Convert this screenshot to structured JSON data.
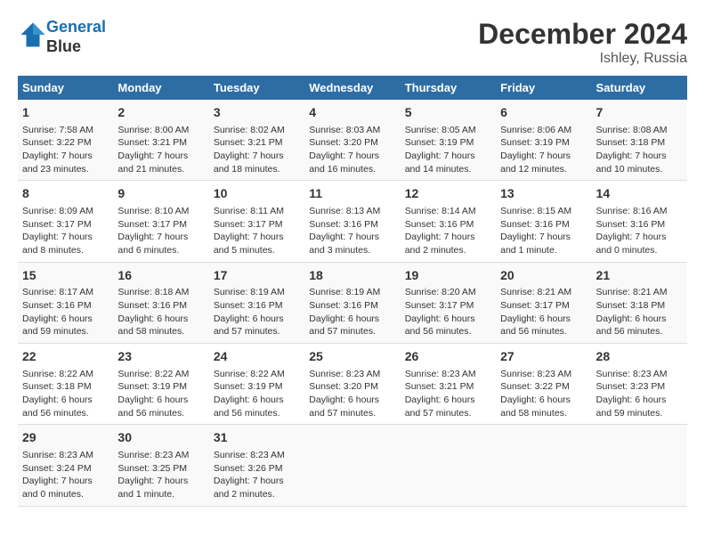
{
  "header": {
    "logo_line1": "General",
    "logo_line2": "Blue",
    "title": "December 2024",
    "subtitle": "Ishley, Russia"
  },
  "days_of_week": [
    "Sunday",
    "Monday",
    "Tuesday",
    "Wednesday",
    "Thursday",
    "Friday",
    "Saturday"
  ],
  "weeks": [
    [
      {
        "day": "1",
        "info": "Sunrise: 7:58 AM\nSunset: 3:22 PM\nDaylight: 7 hours\nand 23 minutes."
      },
      {
        "day": "2",
        "info": "Sunrise: 8:00 AM\nSunset: 3:21 PM\nDaylight: 7 hours\nand 21 minutes."
      },
      {
        "day": "3",
        "info": "Sunrise: 8:02 AM\nSunset: 3:21 PM\nDaylight: 7 hours\nand 18 minutes."
      },
      {
        "day": "4",
        "info": "Sunrise: 8:03 AM\nSunset: 3:20 PM\nDaylight: 7 hours\nand 16 minutes."
      },
      {
        "day": "5",
        "info": "Sunrise: 8:05 AM\nSunset: 3:19 PM\nDaylight: 7 hours\nand 14 minutes."
      },
      {
        "day": "6",
        "info": "Sunrise: 8:06 AM\nSunset: 3:19 PM\nDaylight: 7 hours\nand 12 minutes."
      },
      {
        "day": "7",
        "info": "Sunrise: 8:08 AM\nSunset: 3:18 PM\nDaylight: 7 hours\nand 10 minutes."
      }
    ],
    [
      {
        "day": "8",
        "info": "Sunrise: 8:09 AM\nSunset: 3:17 PM\nDaylight: 7 hours\nand 8 minutes."
      },
      {
        "day": "9",
        "info": "Sunrise: 8:10 AM\nSunset: 3:17 PM\nDaylight: 7 hours\nand 6 minutes."
      },
      {
        "day": "10",
        "info": "Sunrise: 8:11 AM\nSunset: 3:17 PM\nDaylight: 7 hours\nand 5 minutes."
      },
      {
        "day": "11",
        "info": "Sunrise: 8:13 AM\nSunset: 3:16 PM\nDaylight: 7 hours\nand 3 minutes."
      },
      {
        "day": "12",
        "info": "Sunrise: 8:14 AM\nSunset: 3:16 PM\nDaylight: 7 hours\nand 2 minutes."
      },
      {
        "day": "13",
        "info": "Sunrise: 8:15 AM\nSunset: 3:16 PM\nDaylight: 7 hours\nand 1 minute."
      },
      {
        "day": "14",
        "info": "Sunrise: 8:16 AM\nSunset: 3:16 PM\nDaylight: 7 hours\nand 0 minutes."
      }
    ],
    [
      {
        "day": "15",
        "info": "Sunrise: 8:17 AM\nSunset: 3:16 PM\nDaylight: 6 hours\nand 59 minutes."
      },
      {
        "day": "16",
        "info": "Sunrise: 8:18 AM\nSunset: 3:16 PM\nDaylight: 6 hours\nand 58 minutes."
      },
      {
        "day": "17",
        "info": "Sunrise: 8:19 AM\nSunset: 3:16 PM\nDaylight: 6 hours\nand 57 minutes."
      },
      {
        "day": "18",
        "info": "Sunrise: 8:19 AM\nSunset: 3:16 PM\nDaylight: 6 hours\nand 57 minutes."
      },
      {
        "day": "19",
        "info": "Sunrise: 8:20 AM\nSunset: 3:17 PM\nDaylight: 6 hours\nand 56 minutes."
      },
      {
        "day": "20",
        "info": "Sunrise: 8:21 AM\nSunset: 3:17 PM\nDaylight: 6 hours\nand 56 minutes."
      },
      {
        "day": "21",
        "info": "Sunrise: 8:21 AM\nSunset: 3:18 PM\nDaylight: 6 hours\nand 56 minutes."
      }
    ],
    [
      {
        "day": "22",
        "info": "Sunrise: 8:22 AM\nSunset: 3:18 PM\nDaylight: 6 hours\nand 56 minutes."
      },
      {
        "day": "23",
        "info": "Sunrise: 8:22 AM\nSunset: 3:19 PM\nDaylight: 6 hours\nand 56 minutes."
      },
      {
        "day": "24",
        "info": "Sunrise: 8:22 AM\nSunset: 3:19 PM\nDaylight: 6 hours\nand 56 minutes."
      },
      {
        "day": "25",
        "info": "Sunrise: 8:23 AM\nSunset: 3:20 PM\nDaylight: 6 hours\nand 57 minutes."
      },
      {
        "day": "26",
        "info": "Sunrise: 8:23 AM\nSunset: 3:21 PM\nDaylight: 6 hours\nand 57 minutes."
      },
      {
        "day": "27",
        "info": "Sunrise: 8:23 AM\nSunset: 3:22 PM\nDaylight: 6 hours\nand 58 minutes."
      },
      {
        "day": "28",
        "info": "Sunrise: 8:23 AM\nSunset: 3:23 PM\nDaylight: 6 hours\nand 59 minutes."
      }
    ],
    [
      {
        "day": "29",
        "info": "Sunrise: 8:23 AM\nSunset: 3:24 PM\nDaylight: 7 hours\nand 0 minutes."
      },
      {
        "day": "30",
        "info": "Sunrise: 8:23 AM\nSunset: 3:25 PM\nDaylight: 7 hours\nand 1 minute."
      },
      {
        "day": "31",
        "info": "Sunrise: 8:23 AM\nSunset: 3:26 PM\nDaylight: 7 hours\nand 2 minutes."
      },
      {
        "day": "",
        "info": ""
      },
      {
        "day": "",
        "info": ""
      },
      {
        "day": "",
        "info": ""
      },
      {
        "day": "",
        "info": ""
      }
    ]
  ]
}
